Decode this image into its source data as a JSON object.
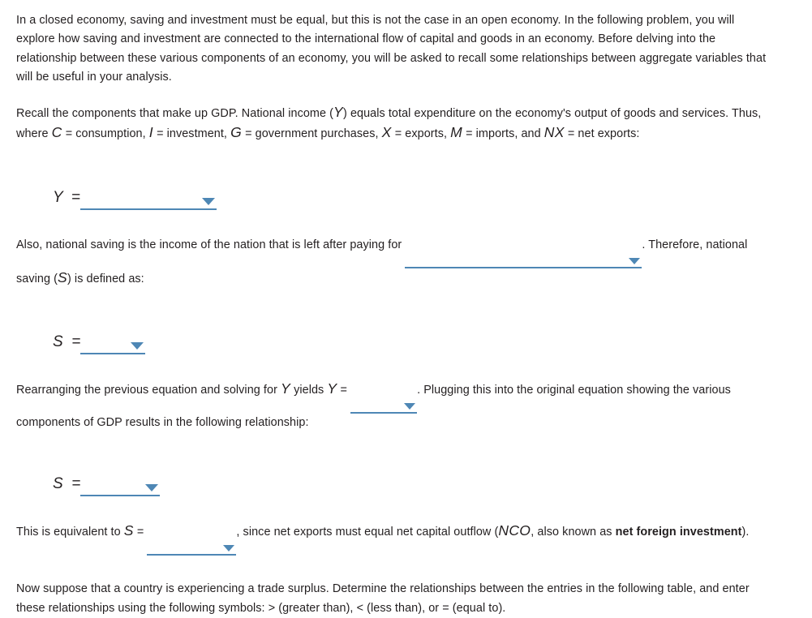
{
  "document": {
    "intro_paragraph": "In a closed economy, saving and investment must be equal, but this is not the case in an open economy. In the following problem, you will explore how saving and investment are connected to the international flow of capital and goods in an economy. Before delving into the relationship between these various components of an economy, you will be asked to recall some relationships between aggregate variables that will be useful in your analysis.",
    "recall_paragraph": {
      "part1": "Recall the components that make up GDP. National income (",
      "var_Y": "Y",
      "part2": ") equals total expenditure on the economy's output of goods and services. Thus, where ",
      "var_C": "C",
      "part3": " = consumption, ",
      "var_I": "I",
      "part4": " = investment, ",
      "var_G": "G",
      "part5": " = government purchases, ",
      "var_X": "X",
      "part6": " = exports, ",
      "var_M": "M",
      "part7": " = imports, and ",
      "var_NX": "NX",
      "part8": " = net exports:"
    },
    "equation_y": {
      "lhs": "Y  =",
      "dropdown_value": "",
      "dropdown_name": "y-equation-dropdown"
    },
    "saving_paragraph": {
      "part1": "Also, national saving is the income of the nation that is left after paying for",
      "dropdown_value": "",
      "part2": ". Therefore, national saving (",
      "var_S": "S",
      "part3": ") is defined as:"
    },
    "equation_s1": {
      "lhs": "S  =",
      "dropdown_value": "",
      "dropdown_name": "s-equation-dropdown-1"
    },
    "rearranging_paragraph": {
      "part1": "Rearranging the previous equation and solving for ",
      "var_Y1": "Y",
      "part2": " yields ",
      "var_Y2": "Y",
      "part3": " = ",
      "dropdown_value": "",
      "part4": ". Plugging this into the original equation showing the various components of GDP results in the following relationship:"
    },
    "equation_s2": {
      "lhs": "S  =",
      "dropdown_value": "",
      "dropdown_name": "s-equation-dropdown-2"
    },
    "equivalent_paragraph": {
      "part1": "This is equivalent to ",
      "var_S": "S",
      "part2": " = ",
      "dropdown_value": "",
      "part3": ", since net exports must equal net capital outflow (",
      "var_NCO": "NCO",
      "part4": ", also known as ",
      "bold_term": "net foreign investment",
      "part5": ")."
    },
    "trade_surplus_paragraph": "Now suppose that a country is experiencing a trade surplus. Determine the relationships between the entries in the following table, and enter these relationships using the following symbols: > (greater than), < (less than), or = (equal to)."
  },
  "colors": {
    "accent_blue": "#4e87b5",
    "text": "#231f20",
    "background": "#ffffff"
  }
}
